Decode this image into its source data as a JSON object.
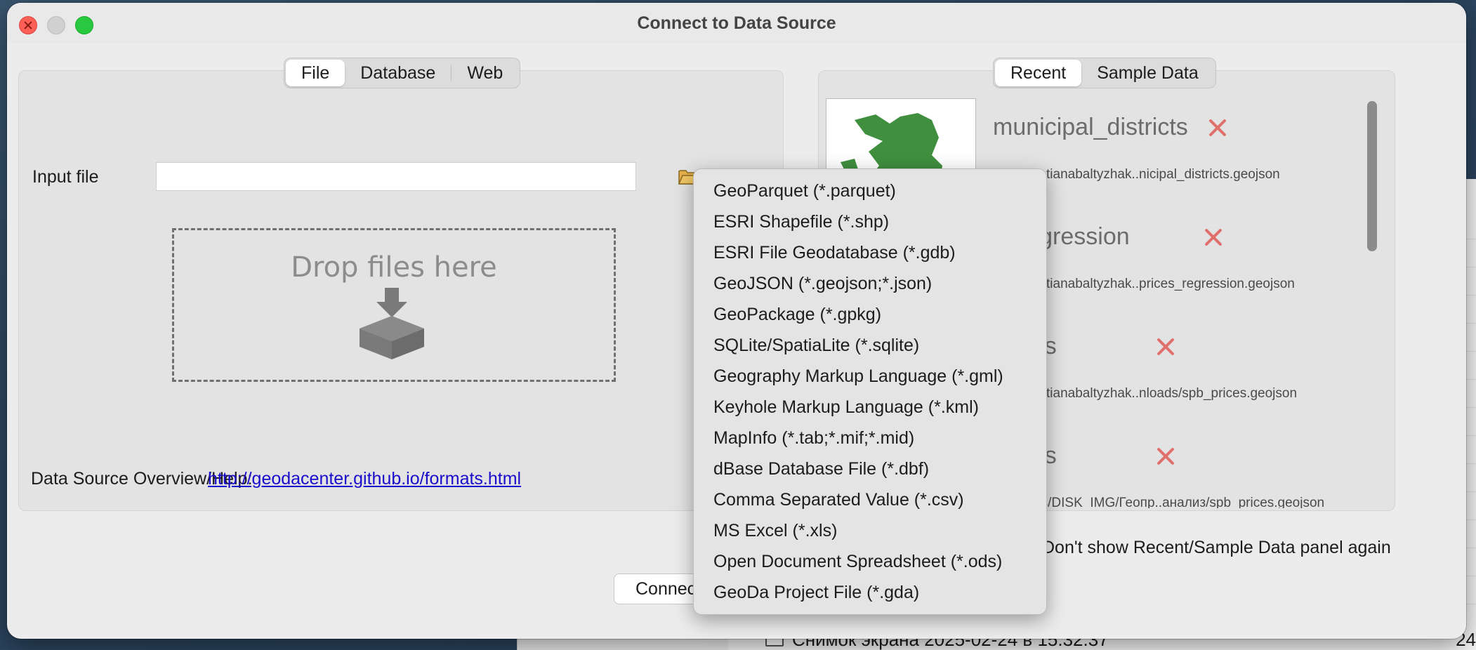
{
  "window": {
    "title": "Connect to Data Source"
  },
  "left_tabs": [
    "File",
    "Database",
    "Web"
  ],
  "right_tabs": [
    "Recent",
    "Sample Data"
  ],
  "input": {
    "label": "Input file",
    "value": ""
  },
  "drop_zone": {
    "text": "Drop files here"
  },
  "help": {
    "label": "Data Source Overview/Help:",
    "link": "http://geodacenter.github.io/formats.html"
  },
  "recent": [
    {
      "title": "municipal_districts",
      "path": "/Users/tatianabaltyzhak..nicipal_districts.geojson"
    },
    {
      "title": "s_regression",
      "path": "/Users/tatianabaltyzhak..prices_regression.geojson"
    },
    {
      "title": "prices",
      "path": "/Users/tatianabaltyzhak..nloads/spb_prices.geojson"
    },
    {
      "title": "prices",
      "path": "/Volumes/DISK_IMG/Геопр..анализ/spb_prices.geojson"
    }
  ],
  "dont_show": {
    "label": "Don't show Recent/Sample Data panel again"
  },
  "connect_button": {
    "label": "Connect"
  },
  "format_menu": [
    "GeoParquet (*.parquet)",
    "ESRI Shapefile (*.shp)",
    "ESRI File Geodatabase (*.gdb)",
    "GeoJSON (*.geojson;*.json)",
    "GeoPackage (*.gpkg)",
    "SQLite/SpatiaLite (*.sqlite)",
    "Geography Markup Language (*.gml)",
    "Keyhole Markup Language (*.kml)",
    "MapInfo (*.tab;*.mif;*.mid)",
    "dBase Database File (*.dbf)",
    "Comma Separated Value (*.csv)",
    "MS Excel (*.xls)",
    "Open Document Spreadsheet (*.ods)",
    "GeoDa Project File (*.gda)"
  ],
  "background_finder": {
    "file_name": "Снимок экрана 2025-02-24 в 15.32.37",
    "file_size": "24"
  },
  "colors": {
    "close_x": "#e0706c",
    "link": "#1a0dcc",
    "map_green": "#3f8f3f"
  }
}
